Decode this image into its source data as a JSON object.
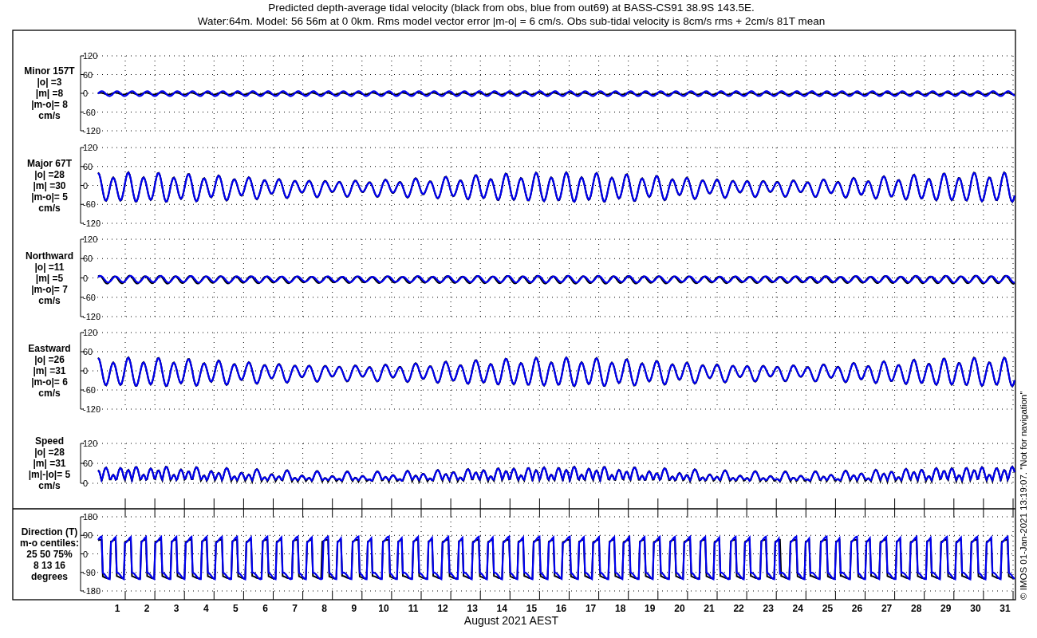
{
  "title": [
    "Predicted depth-average tidal velocity (black from obs, blue from out69) at BASS-CS91 38.9S 143.5E.",
    "Water:64m. Model: 56 56m at 0 0km. Rms model vector error |m-o| = 6 cm/s. Obs sub-tidal velocity is 8cm/s rms + 2cm/s 81T mean"
  ],
  "panels": [
    {
      "kind": "minor",
      "label": [
        "Minor 157T",
        "|o| =3",
        "|m| =8",
        "|m-o|= 8",
        "cm/s"
      ],
      "yticks": [
        "120",
        "60",
        "0",
        "-60",
        "-120"
      ]
    },
    {
      "kind": "major",
      "label": [
        "Major 67T",
        "|o| =28",
        "|m| =30",
        "|m-o|= 5",
        "cm/s"
      ],
      "yticks": [
        "120",
        "60",
        "0",
        "-60",
        "-120"
      ]
    },
    {
      "kind": "north",
      "label": [
        "Northward",
        "|o| =11",
        "|m| =5",
        "|m-o|= 7",
        "cm/s"
      ],
      "yticks": [
        "120",
        "60",
        "0",
        "-60",
        "-120"
      ]
    },
    {
      "kind": "east",
      "label": [
        "Eastward",
        "|o| =26",
        "|m| =31",
        "|m-o|= 6",
        "cm/s"
      ],
      "yticks": [
        "120",
        "60",
        "0",
        "-60",
        "-120"
      ]
    },
    {
      "kind": "speed",
      "label": [
        "Speed",
        "|o| =28",
        "|m| =31",
        "|m|-|o|= 5",
        "cm/s"
      ],
      "yticks": [
        "120",
        "60",
        "0"
      ]
    },
    {
      "kind": "direction",
      "label": [
        "Direction (T)",
        "m-o centiles:",
        "25  50  75%",
        "8  13  16",
        "degrees"
      ],
      "yticks": [
        "180",
        "90",
        "0",
        "-90",
        "-180"
      ]
    }
  ],
  "days": [
    "1",
    "2",
    "3",
    "4",
    "5",
    "6",
    "7",
    "8",
    "9",
    "10",
    "11",
    "12",
    "13",
    "14",
    "15",
    "16",
    "17",
    "18",
    "19",
    "20",
    "21",
    "22",
    "23",
    "24",
    "25",
    "26",
    "27",
    "28",
    "29",
    "30",
    "31"
  ],
  "xlabel": "August 2021 AEST",
  "credit": "© IMOS 01-Jan-2021 13:19:07. \"Not for navigation\""
}
